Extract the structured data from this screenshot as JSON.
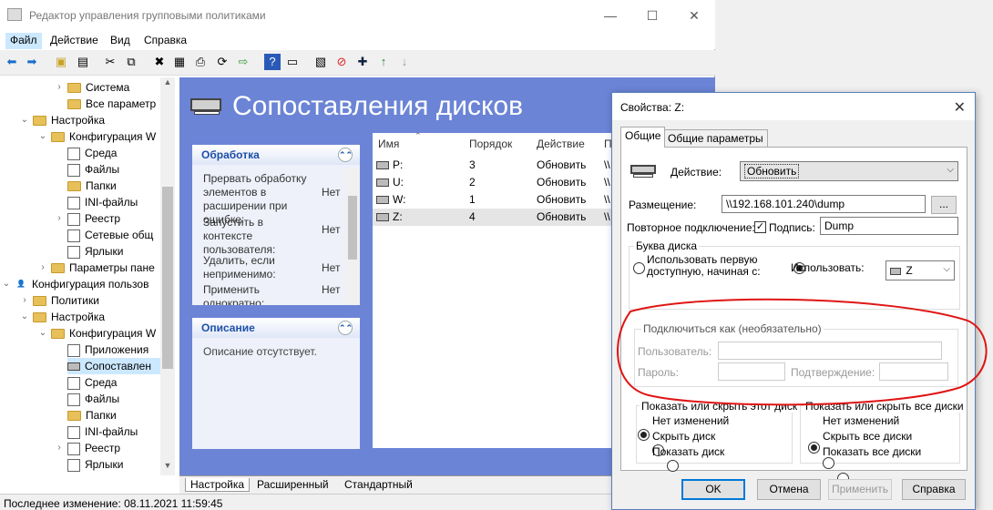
{
  "window": {
    "title": "Редактор управления групповыми политиками"
  },
  "menu": [
    "Файл",
    "Действие",
    "Вид",
    "Справка"
  ],
  "tree": {
    "items": [
      {
        "label": "Система",
        "indent": 3,
        "arrow": "›",
        "icon": "folder"
      },
      {
        "label": "Все параметр",
        "indent": 3,
        "arrow": "",
        "icon": "folder"
      },
      {
        "label": "Настройка",
        "indent": 1,
        "arrow": "⌄",
        "icon": "folder"
      },
      {
        "label": "Конфигурация W",
        "indent": 2,
        "arrow": "⌄",
        "icon": "folder"
      },
      {
        "label": "Среда",
        "indent": 3,
        "arrow": "",
        "icon": "file"
      },
      {
        "label": "Файлы",
        "indent": 3,
        "arrow": "",
        "icon": "file"
      },
      {
        "label": "Папки",
        "indent": 3,
        "arrow": "",
        "icon": "folder"
      },
      {
        "label": "INI-файлы",
        "indent": 3,
        "arrow": "",
        "icon": "file"
      },
      {
        "label": "Реестр",
        "indent": 3,
        "arrow": "›",
        "icon": "file"
      },
      {
        "label": "Сетевые общ",
        "indent": 3,
        "arrow": "",
        "icon": "file"
      },
      {
        "label": "Ярлыки",
        "indent": 3,
        "arrow": "",
        "icon": "file"
      },
      {
        "label": "Параметры пане",
        "indent": 2,
        "arrow": "›",
        "icon": "folder"
      },
      {
        "label": "Конфигурация пользов",
        "indent": 0,
        "arrow": "⌄",
        "icon": "user"
      },
      {
        "label": "Политики",
        "indent": 1,
        "arrow": "›",
        "icon": "folder"
      },
      {
        "label": "Настройка",
        "indent": 1,
        "arrow": "⌄",
        "icon": "folder"
      },
      {
        "label": "Конфигурация W",
        "indent": 2,
        "arrow": "⌄",
        "icon": "folder"
      },
      {
        "label": "Приложения",
        "indent": 3,
        "arrow": "",
        "icon": "file"
      },
      {
        "label": "Сопоставлен",
        "indent": 3,
        "arrow": "",
        "icon": "drive",
        "selected": true
      },
      {
        "label": "Среда",
        "indent": 3,
        "arrow": "",
        "icon": "file"
      },
      {
        "label": "Файлы",
        "indent": 3,
        "arrow": "",
        "icon": "file"
      },
      {
        "label": "Папки",
        "indent": 3,
        "arrow": "",
        "icon": "folder"
      },
      {
        "label": "INI-файлы",
        "indent": 3,
        "arrow": "",
        "icon": "file"
      },
      {
        "label": "Реестр",
        "indent": 3,
        "arrow": "›",
        "icon": "file"
      },
      {
        "label": "Ярлыки",
        "indent": 3,
        "arrow": "",
        "icon": "file"
      }
    ]
  },
  "panel": {
    "title": "Сопоставления дисков",
    "processing": {
      "header": "Обработка",
      "rows": [
        {
          "label": "Прервать обработку элементов в расширении при ошибке:",
          "value": "Нет"
        },
        {
          "label": "Запустить в контексте пользователя:",
          "value": "Нет"
        },
        {
          "label": "Удалить, если неприменимо:",
          "value": "Нет"
        },
        {
          "label": "Применить однократно:",
          "value": "Нет"
        }
      ]
    },
    "description": {
      "header": "Описание",
      "text": "Описание отсутствует."
    },
    "list": {
      "columns": [
        "Имя",
        "Порядок",
        "Действие",
        "П"
      ],
      "rows": [
        {
          "name": "P:",
          "order": "3",
          "action": "Обновить",
          "extra": "\\\\"
        },
        {
          "name": "U:",
          "order": "2",
          "action": "Обновить",
          "extra": "\\\\"
        },
        {
          "name": "W:",
          "order": "1",
          "action": "Обновить",
          "extra": "\\\\"
        },
        {
          "name": "Z:",
          "order": "4",
          "action": "Обновить",
          "extra": "\\\\",
          "selected": true
        }
      ]
    }
  },
  "bottom_tabs": [
    "Настройка",
    "Расширенный",
    "Стандартный"
  ],
  "status": "Последнее изменение: 08.11.2021 11:59:45",
  "dialog": {
    "title": "Свойства: Z:",
    "tabs": [
      "Общие",
      "Общие параметры"
    ],
    "action_label": "Действие:",
    "action_value": "Обновить",
    "location_label": "Размещение:",
    "location_value": "\\\\192.168.101.240\\dump",
    "browse": "...",
    "reconnect_label": "Повторное подключение:",
    "label_label": "Подпись:",
    "label_value": "Dump",
    "drive_letter_group": "Буква диска",
    "use_first_available": "Использовать первую доступную, начиная с:",
    "use": "Использовать:",
    "drive_letter": "Z",
    "connect_as_group": "Подключиться как (необязательно)",
    "user_label": "Пользователь:",
    "password_label": "Пароль:",
    "confirm_label": "Подтверждение:",
    "show_hide_drive_group": "Показать или скрыть этот диск",
    "show_hide_all_group": "Показать или скрыть все диски",
    "drive_options": [
      "Нет изменений",
      "Скрыть диск",
      "Показать диск"
    ],
    "all_options": [
      "Нет изменений",
      "Скрыть все диски",
      "Показать все диски"
    ],
    "buttons": {
      "ok": "OK",
      "cancel": "Отмена",
      "apply": "Применить",
      "help": "Справка"
    }
  }
}
